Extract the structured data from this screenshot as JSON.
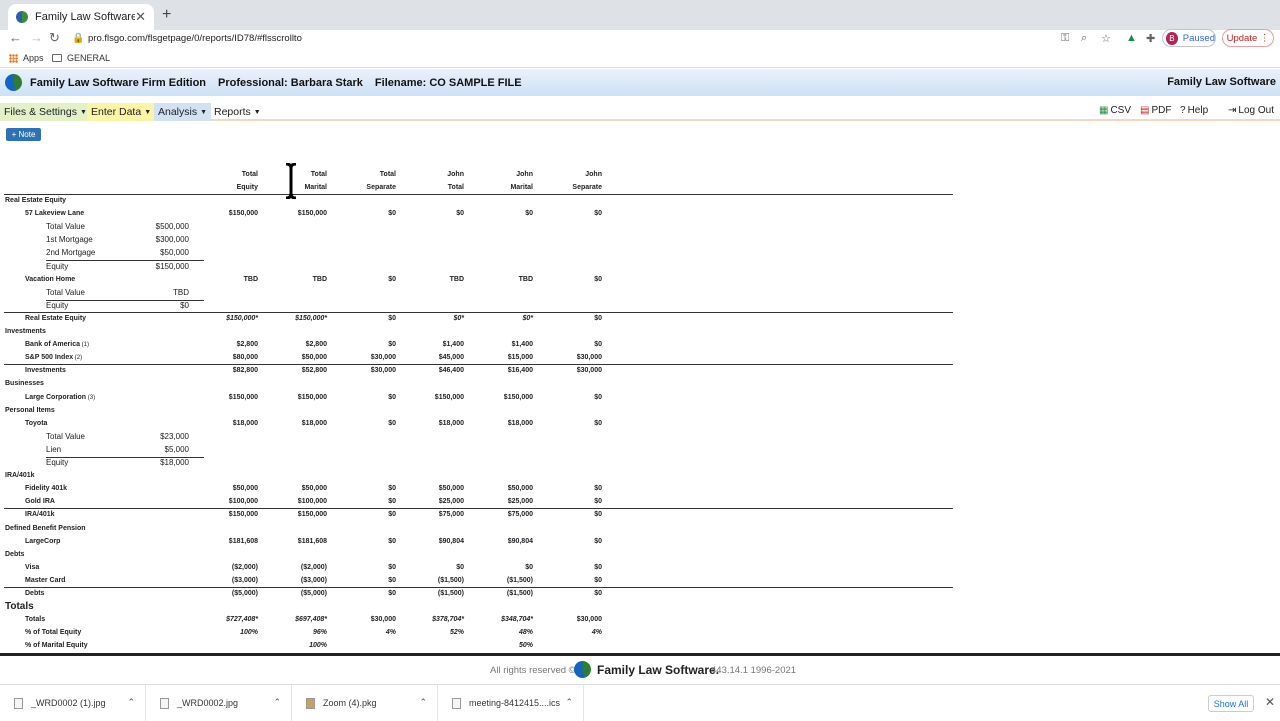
{
  "browser": {
    "tab_title": "Family Law Software",
    "new_tab": "+",
    "url": "pro.flsgo.com/flsgetpage/0/reports/ID78/#flsscrollto",
    "paused": "Paused",
    "avatar": "B",
    "update": "Update",
    "bookmarks": [
      "Apps",
      "GENERAL"
    ]
  },
  "app": {
    "name": "Family Law Software Firm Edition",
    "professional": "Professional: Barbara Stark",
    "filename": "Filename: CO SAMPLE FILE",
    "brand": "Family Law Software"
  },
  "menu": {
    "files": "Files & Settings",
    "enter": "Enter Data",
    "analysis": "Analysis",
    "reports": "Reports",
    "csv": "CSV",
    "pdf": "PDF",
    "help": "Help",
    "logout": "Log Out"
  },
  "note_button": "Note",
  "columns": [
    [
      "Total",
      "Equity"
    ],
    [
      "Total",
      "Marital"
    ],
    [
      "Total",
      "Separate"
    ],
    [
      "John",
      "Total"
    ],
    [
      "John",
      "Marital"
    ],
    [
      "John",
      "Separate"
    ]
  ],
  "rows": [
    {
      "type": "section",
      "label": "Real Estate Equity"
    },
    {
      "type": "item",
      "label": "57 Lakeview Lane",
      "vals": [
        "$150,000",
        "$150,000",
        "$0",
        "$0",
        "$0",
        "$0"
      ]
    },
    {
      "type": "sub",
      "label": "Total Value",
      "amt": "$500,000"
    },
    {
      "type": "sub",
      "label": "1st Mortgage",
      "amt": "$300,000"
    },
    {
      "type": "sub",
      "label": "2nd Mortgage",
      "amt": "$50,000",
      "rule": true
    },
    {
      "type": "sub",
      "label": "Equity",
      "amt": "$150,000"
    },
    {
      "type": "item",
      "label": "Vacation Home",
      "vals": [
        "TBD",
        "TBD",
        "$0",
        "TBD",
        "TBD",
        "$0"
      ]
    },
    {
      "type": "sub",
      "label": "Total Value",
      "amt": "TBD",
      "rule": true
    },
    {
      "type": "sub",
      "label": "Equity",
      "amt": "$0"
    },
    {
      "type": "total",
      "label": "Real Estate Equity",
      "vals": [
        "$150,000*",
        "$150,000*",
        "$0",
        "$0*",
        "$0*",
        "$0"
      ],
      "italic": [
        0,
        1,
        3,
        4
      ]
    },
    {
      "type": "section",
      "label": "Investments"
    },
    {
      "type": "item",
      "label": "Bank of America",
      "note": "(1)",
      "vals": [
        "$2,800",
        "$2,800",
        "$0",
        "$1,400",
        "$1,400",
        "$0"
      ]
    },
    {
      "type": "item",
      "label": "S&P 500 Index",
      "note": "(2)",
      "vals": [
        "$80,000",
        "$50,000",
        "$30,000",
        "$45,000",
        "$15,000",
        "$30,000"
      ]
    },
    {
      "type": "total",
      "label": "Investments",
      "vals": [
        "$82,800",
        "$52,800",
        "$30,000",
        "$46,400",
        "$16,400",
        "$30,000"
      ]
    },
    {
      "type": "section",
      "label": "Businesses"
    },
    {
      "type": "item",
      "label": "Large Corporation",
      "note": "(3)",
      "vals": [
        "$150,000",
        "$150,000",
        "$0",
        "$150,000",
        "$150,000",
        "$0"
      ]
    },
    {
      "type": "section",
      "label": "Personal Items"
    },
    {
      "type": "item",
      "label": "Toyota",
      "vals": [
        "$18,000",
        "$18,000",
        "$0",
        "$18,000",
        "$18,000",
        "$0"
      ]
    },
    {
      "type": "sub",
      "label": "Total Value",
      "amt": "$23,000"
    },
    {
      "type": "sub",
      "label": "Lien",
      "amt": "$5,000",
      "rule": true
    },
    {
      "type": "sub",
      "label": "Equity",
      "amt": "$18,000"
    },
    {
      "type": "section",
      "label": "IRA/401k"
    },
    {
      "type": "item",
      "label": "Fidelity 401k",
      "vals": [
        "$50,000",
        "$50,000",
        "$0",
        "$50,000",
        "$50,000",
        "$0"
      ]
    },
    {
      "type": "item",
      "label": "Gold IRA",
      "vals": [
        "$100,000",
        "$100,000",
        "$0",
        "$25,000",
        "$25,000",
        "$0"
      ]
    },
    {
      "type": "total",
      "label": "IRA/401k",
      "vals": [
        "$150,000",
        "$150,000",
        "$0",
        "$75,000",
        "$75,000",
        "$0"
      ]
    },
    {
      "type": "section",
      "label": "Defined Benefit Pension"
    },
    {
      "type": "item",
      "label": "LargeCorp",
      "vals": [
        "$181,608",
        "$181,608",
        "$0",
        "$90,804",
        "$90,804",
        "$0"
      ]
    },
    {
      "type": "section",
      "label": "Debts"
    },
    {
      "type": "item",
      "label": "Visa",
      "vals": [
        "($2,000)",
        "($2,000)",
        "$0",
        "$0",
        "$0",
        "$0"
      ]
    },
    {
      "type": "item",
      "label": "Master Card",
      "vals": [
        "($3,000)",
        "($3,000)",
        "$0",
        "($1,500)",
        "($1,500)",
        "$0"
      ]
    },
    {
      "type": "total",
      "label": "Debts",
      "vals": [
        "($5,000)",
        "($5,000)",
        "$0",
        "($1,500)",
        "($1,500)",
        "$0"
      ]
    },
    {
      "type": "bigsection",
      "label": "Totals"
    },
    {
      "type": "item",
      "label": "Totals",
      "vals": [
        "$727,408*",
        "$697,408*",
        "$30,000",
        "$378,704*",
        "$348,704*",
        "$30,000"
      ],
      "italic": [
        0,
        1,
        3,
        4
      ]
    },
    {
      "type": "item",
      "label": "% of Total Equity",
      "vals": [
        "100%",
        "96%",
        "4%",
        "52%",
        "48%",
        "4%"
      ],
      "italic": [
        0,
        1,
        2,
        3,
        4,
        5
      ]
    },
    {
      "type": "item",
      "label": "% of Marital Equity",
      "vals": [
        "",
        "100%",
        "",
        "",
        "50%",
        ""
      ],
      "italic": [
        1,
        4
      ]
    }
  ],
  "footer": {
    "rights": "All rights reserved ©",
    "brand": "Family Law Software.",
    "version": "443.14.1 1996-2021"
  },
  "downloads": [
    "_WRD0002 (1).jpg",
    "_WRD0002.jpg",
    "Zoom (4).pkg",
    "meeting-8412415....ics"
  ],
  "show_all": "Show All"
}
